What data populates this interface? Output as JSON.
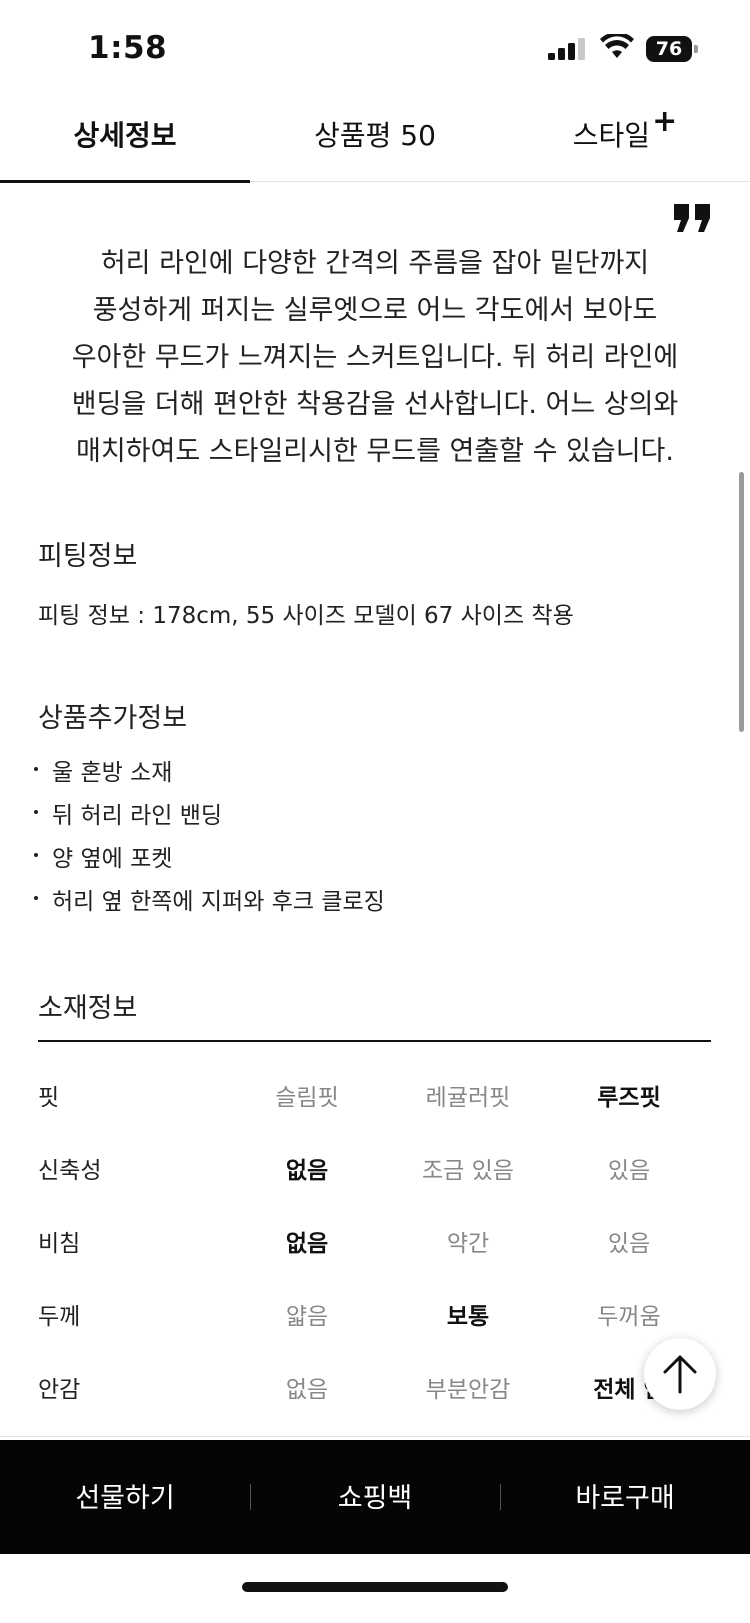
{
  "status_bar": {
    "time": "1:58",
    "battery_level": "76",
    "icons": [
      "cellular-signal-icon",
      "wifi-icon",
      "battery-icon"
    ]
  },
  "tabs": [
    {
      "label": "상세정보",
      "active": true
    },
    {
      "label": "상품평 50",
      "active": false
    },
    {
      "label": "스타일",
      "suffix": "+",
      "active": false
    }
  ],
  "intro": {
    "lines": [
      "허리 라인에 다양한 간격의 주름을 잡아 밑단까지",
      "풍성하게 퍼지는 실루엣으로 어느 각도에서 보아도",
      "우아한 무드가 느껴지는 스커트입니다. 뒤 허리 라인에",
      "밴딩을 더해 편안한 착용감을 선사합니다. 어느 상의와",
      "매치하여도 스타일리시한 무드를 연출할 수 있습니다."
    ]
  },
  "fitting": {
    "title": "피팅정보",
    "text": "피팅 정보 : 178cm, 55 사이즈 모델이 67 사이즈 착용"
  },
  "extra": {
    "title": "상품추가정보",
    "items": [
      "울 혼방 소재",
      "뒤 허리 라인 밴딩",
      "양 옆에 포켓",
      "허리 옆 한쪽에 지퍼와 후크 클로징"
    ]
  },
  "material": {
    "title": "소재정보",
    "rows": [
      {
        "label": "핏",
        "options": [
          "슬림핏",
          "레귤러핏",
          "루즈핏"
        ],
        "selected": 2
      },
      {
        "label": "신축성",
        "options": [
          "없음",
          "조금 있음",
          "있음"
        ],
        "selected": 0
      },
      {
        "label": "비침",
        "options": [
          "없음",
          "약간",
          "있음"
        ],
        "selected": 0
      },
      {
        "label": "두께",
        "options": [
          "얇음",
          "보통",
          "두꺼움"
        ],
        "selected": 1
      },
      {
        "label": "안감",
        "options": [
          "없음",
          "부분안감",
          "전체 안"
        ],
        "selected": 2
      }
    ]
  },
  "actions": {
    "gift": "선물하기",
    "cart": "쇼핑백",
    "buy": "바로구매"
  },
  "colors": {
    "action_bar": "#050505",
    "selected_option": "#111111",
    "unselected_option": "#888888"
  }
}
